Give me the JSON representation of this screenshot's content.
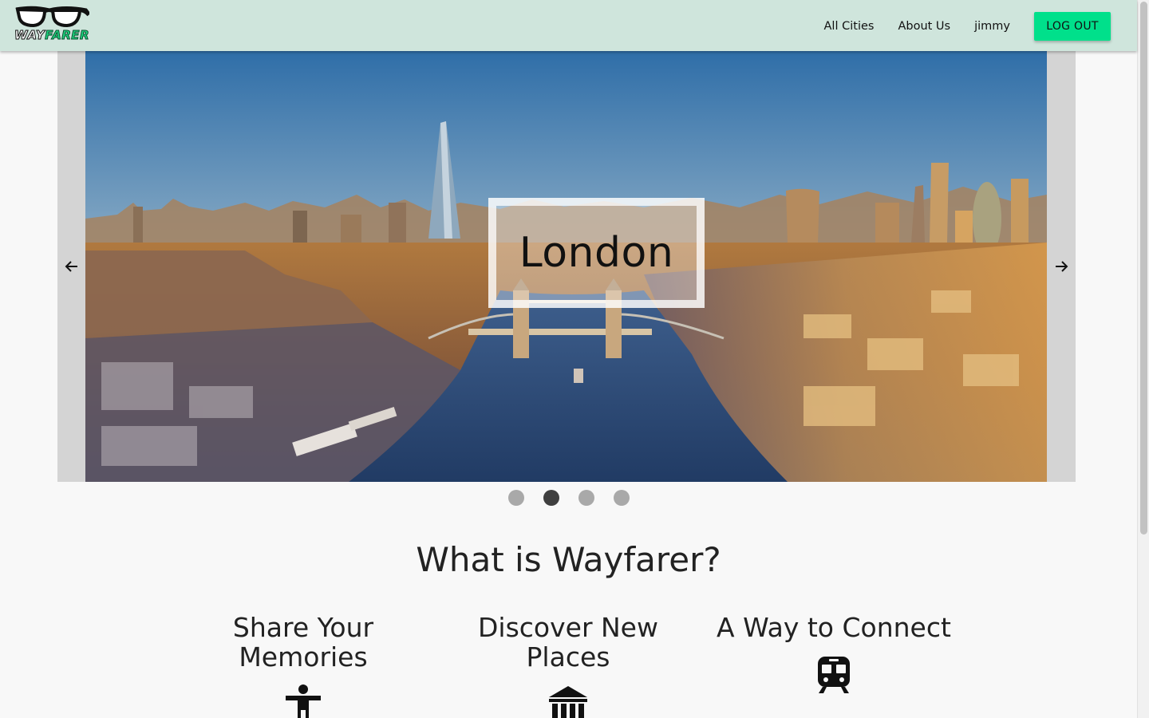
{
  "navbar": {
    "logo_way": "WAY",
    "logo_farer": "FARER",
    "links": [
      {
        "label": "All Cities"
      },
      {
        "label": "About Us"
      },
      {
        "label": "jimmy"
      }
    ],
    "logout_label": "LOG OUT",
    "accent_color": "#00e08b",
    "bg_color": "#cfe5dc"
  },
  "carousel": {
    "caption": "London",
    "prev_icon": "arrow-left-icon",
    "next_icon": "arrow-right-icon",
    "active_index": 1,
    "slide_count": 4
  },
  "about": {
    "title": "What is Wayfarer?",
    "features": [
      {
        "title": "Share Your Memories",
        "icon": "accessibility-icon"
      },
      {
        "title": "Discover New Places",
        "icon": "museum-icon"
      },
      {
        "title": "A Way to Connect",
        "icon": "train-icon"
      }
    ]
  }
}
